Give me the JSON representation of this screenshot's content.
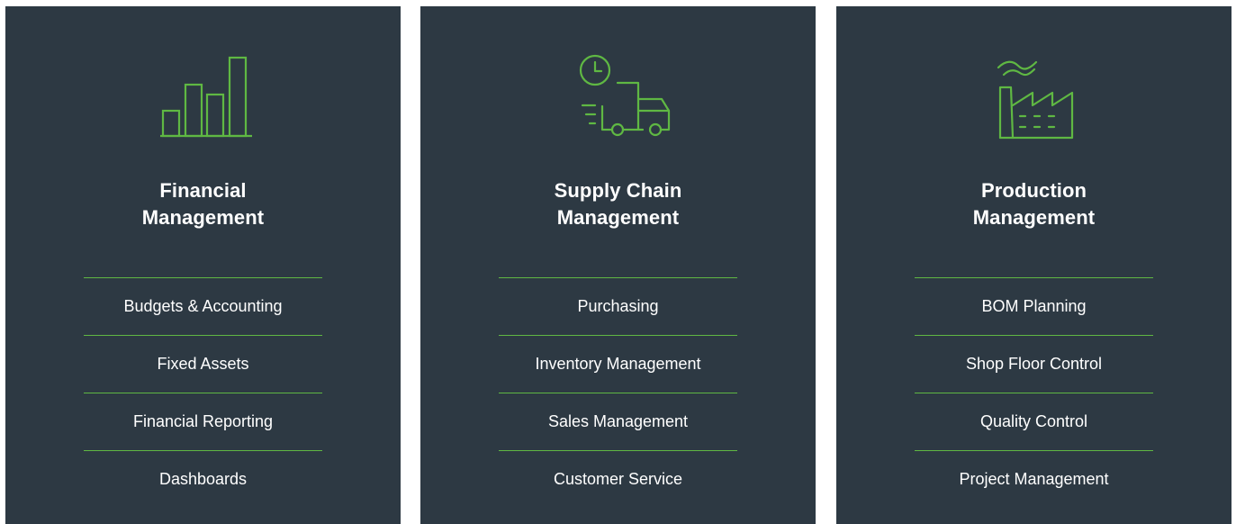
{
  "accent_color": "#5fb843",
  "card_color": "#2d3943",
  "cards": [
    {
      "icon": "bar-chart-icon",
      "title_line1": "Financial",
      "title_line2": "Management",
      "items": [
        "Budgets & Accounting",
        "Fixed Assets",
        "Financial Reporting",
        "Dashboards"
      ]
    },
    {
      "icon": "delivery-truck-clock-icon",
      "title_line1": "Supply Chain",
      "title_line2": "Management",
      "items": [
        "Purchasing",
        "Inventory Management",
        "Sales Management",
        "Customer Service"
      ]
    },
    {
      "icon": "factory-icon",
      "title_line1": "Production",
      "title_line2": "Management",
      "items": [
        "BOM Planning",
        "Shop Floor Control",
        "Quality Control",
        "Project Management"
      ]
    }
  ]
}
